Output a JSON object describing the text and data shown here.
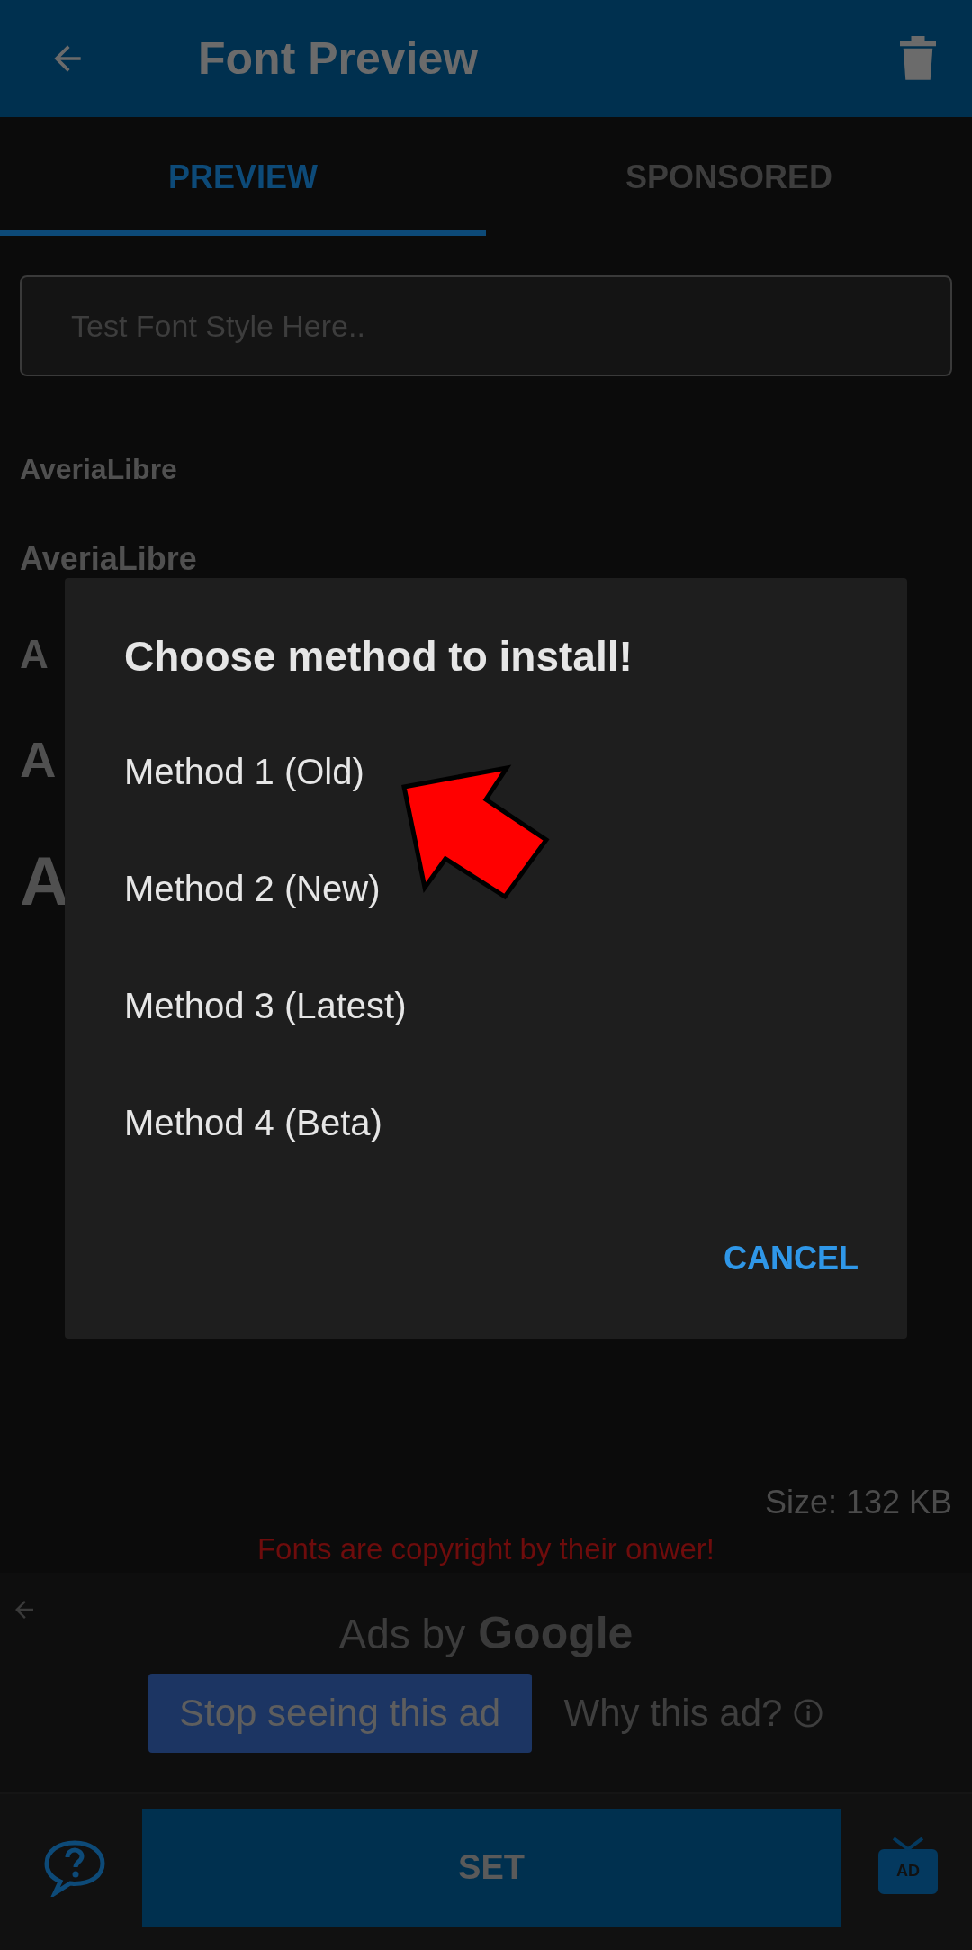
{
  "app_bar": {
    "title": "Font Preview"
  },
  "tabs": [
    {
      "label": "PREVIEW",
      "selected": true
    },
    {
      "label": "SPONSORED",
      "selected": false
    }
  ],
  "search": {
    "placeholder": "Test Font Style Here.."
  },
  "previews": [
    "AveriaLibre",
    "AveriaLibre",
    "A",
    "A",
    "A"
  ],
  "size": "Size: 132 KB",
  "copyright_notice": "Fonts are copyright by their onwer!",
  "ad": {
    "label": "Ads by",
    "brand": "Google",
    "stop_button": "Stop seeing this ad",
    "why_link": "Why this ad?"
  },
  "bottom_bar": {
    "set_button": "SET",
    "ad_icon_label": "AD"
  },
  "dialog": {
    "title": "Choose method to install!",
    "options": [
      "Method 1 (Old)",
      "Method 2 (New)",
      "Method 3 (Latest)",
      "Method 4 (Beta)"
    ],
    "cancel": "CANCEL"
  }
}
